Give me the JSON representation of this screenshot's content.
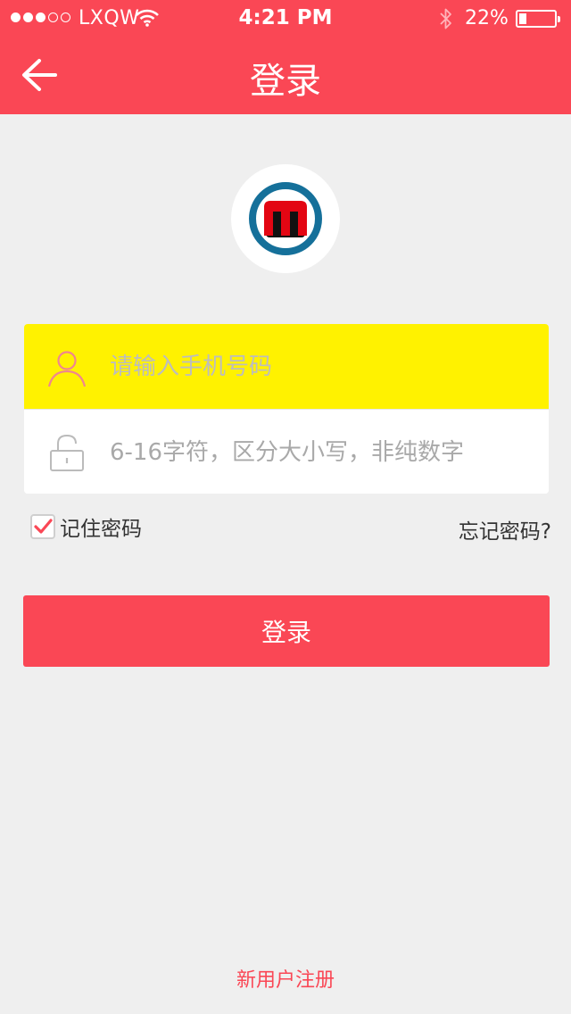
{
  "status_bar": {
    "carrier": "LXQW",
    "time": "4:21 PM",
    "battery_percent": "22%",
    "battery_level": 0.22,
    "signal_bars_filled": 3,
    "signal_bars_total": 5,
    "icons": [
      "wifi-icon",
      "bluetooth-icon",
      "battery-icon"
    ]
  },
  "nav": {
    "title": "登录",
    "back_icon": "arrow-left-icon"
  },
  "logo": {
    "icon": "m-logo-icon"
  },
  "form": {
    "phone": {
      "placeholder": "请输入手机号码",
      "value": "",
      "icon": "user-icon"
    },
    "password": {
      "placeholder": "6-16字符，区分大小写，非纯数字",
      "value": "",
      "icon": "lock-icon"
    },
    "remember_label": "记住密码",
    "remember_checked": true,
    "forgot_label": "忘记密码?"
  },
  "login_button_label": "登录",
  "register_label": "新用户注册",
  "colors": {
    "primary": "#fa4755",
    "focused_field": "#fff200",
    "background": "#efefef"
  }
}
